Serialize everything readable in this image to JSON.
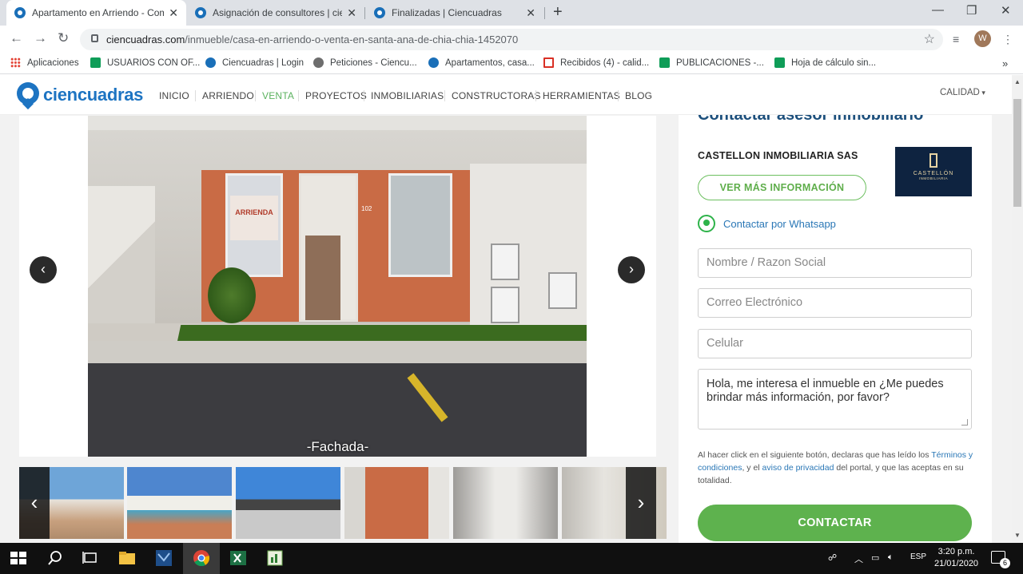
{
  "browser": {
    "tabs": [
      {
        "title": "Apartamento en Arriendo - Com",
        "active": true
      },
      {
        "title": "Asignación de consultores | cienc",
        "active": false
      },
      {
        "title": "Finalizadas | Ciencuadras",
        "active": false
      }
    ],
    "url_host": "ciencuadras.com",
    "url_path": "/inmueble/casa-en-arriendo-o-venta-en-santa-ana-de-chia-chia-1452070",
    "avatar_letter": "W",
    "bookmarks": [
      {
        "label": "Aplicaciones",
        "icon": "apps-grid-icon"
      },
      {
        "label": "USUARIOS CON OF...",
        "icon": "sheets-icon"
      },
      {
        "label": "Ciencuadras | Login",
        "icon": "ciencuadras-icon"
      },
      {
        "label": "Peticiones - Ciencu...",
        "icon": "gear-icon"
      },
      {
        "label": "Apartamentos, casa...",
        "icon": "ciencuadras-icon"
      },
      {
        "label": "Recibidos (4) - calid...",
        "icon": "gmail-icon"
      },
      {
        "label": "PUBLICACIONES -...",
        "icon": "sheets-icon"
      },
      {
        "label": "Hoja de cálculo sin...",
        "icon": "sheets-icon"
      }
    ]
  },
  "site": {
    "logo_text": "ciencuadras",
    "nav": [
      "INICIO",
      "ARRIENDO",
      "VENTA",
      "PROYECTOS",
      "INMOBILIARIAS",
      "CONSTRUCTORAS",
      "HERRAMIENTAS",
      "BLOG"
    ],
    "user_menu": "CALIDAD"
  },
  "gallery": {
    "caption": "-Fachada-",
    "sign_text": "ARRIENDA",
    "door_number": "102",
    "prev_arrow": "‹",
    "next_arrow": "›"
  },
  "contact": {
    "title": "Contactar asesor inmobiliario",
    "agency_name": "CASTELLON INMOBILIARIA SAS",
    "agency_logo_text": "CASTELLÓN",
    "agency_logo_sub": "INMOBILIARIA",
    "more_info_button": "VER MÁS INFORMACIÓN",
    "whatsapp_label": "Contactar por Whatsapp",
    "name_placeholder": "Nombre / Razon Social",
    "email_placeholder": "Correo Electrónico",
    "phone_placeholder": "Celular",
    "message_value": "Hola, me interesa el inmueble en ¿Me puedes brindar más información, por favor?",
    "legal_1": "Al hacer click en el siguiente botón, declaras que has leído los ",
    "legal_terms": "Términos y condiciones",
    "legal_2": ", y el ",
    "legal_privacy": "aviso de privacidad",
    "legal_3": " del portal, y que las aceptas en su totalidad.",
    "submit_button": "CONTACTAR"
  },
  "taskbar": {
    "lang": "ESP",
    "time": "3:20 p.m.",
    "date": "21/01/2020",
    "notifications": "6"
  }
}
